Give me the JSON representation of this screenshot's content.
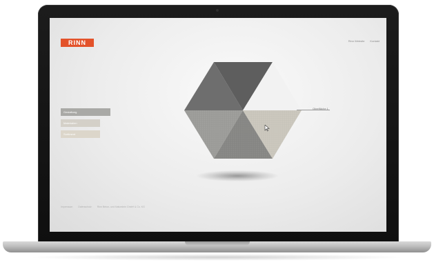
{
  "site": {
    "logo_text": "RINN",
    "brand_color": "#e3522a"
  },
  "top_nav": {
    "items": [
      "Rinn Website",
      "Kontakt"
    ]
  },
  "side_menu": {
    "items": [
      "Gestaltung",
      "Materialien",
      "Sortiment"
    ]
  },
  "hexagon": {
    "segments": [
      {
        "name": "top-left",
        "color": "#6e6e6e"
      },
      {
        "name": "top",
        "color": "#5e5e5e"
      },
      {
        "name": "top-right",
        "color": "#f2f2f2"
      },
      {
        "name": "left",
        "color": "#9d9d9a"
      },
      {
        "name": "bottom",
        "color": "#888885"
      },
      {
        "name": "right",
        "color": "#cbc7bd"
      }
    ],
    "callout_label": "Oberfläche 1"
  },
  "footer": {
    "items": [
      "Impressum",
      "Datenschutz",
      "Rinn Beton- und Naturstein GmbH & Co. KG"
    ]
  }
}
